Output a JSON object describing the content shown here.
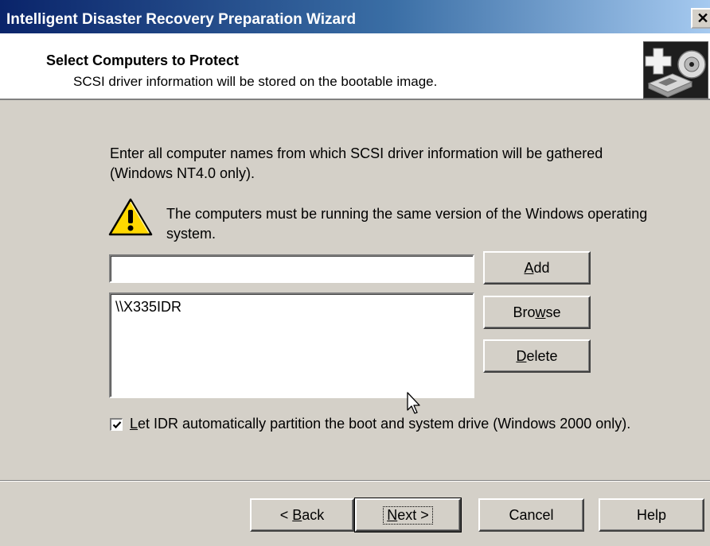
{
  "window": {
    "title": "Intelligent Disaster Recovery Preparation Wizard",
    "close_glyph": "✕",
    "close_icon": "close-icon"
  },
  "header": {
    "heading": "Select Computers to Protect",
    "subheading": "SCSI driver information will be stored on the bootable image.",
    "icon": "disaster-recovery-disk-icon"
  },
  "content": {
    "intro": "Enter all computer names from which SCSI driver information will be gathered (Windows NT4.0 only).",
    "warning_text": "The computers must be running the same version of the Windows operating system.",
    "warning_icon": "warning-icon",
    "computer_name_value": "",
    "computers": [
      "\\\\X335IDR"
    ],
    "checkbox": {
      "checked": true,
      "label_mnemonic": "L",
      "label_rest": "et IDR automatically partition the boot and system drive (Windows 2000 only)."
    }
  },
  "side_buttons": {
    "add": {
      "pre": "",
      "mnemonic": "A",
      "post": "dd"
    },
    "browse": {
      "pre": "Bro",
      "mnemonic": "w",
      "post": "se"
    },
    "delete": {
      "pre": "",
      "mnemonic": "D",
      "post": "elete"
    }
  },
  "footer": {
    "back": {
      "pre": "< ",
      "mnemonic": "B",
      "post": "ack"
    },
    "next": {
      "pre": "",
      "mnemonic": "N",
      "post": "ext >"
    },
    "cancel": "Cancel",
    "help": "Help"
  },
  "colors": {
    "title_gradient_start": "#0a246a",
    "title_gradient_end": "#a6caf0",
    "dialog_face": "#d4d0c8",
    "header_bg": "#ffffff",
    "warning_yellow": "#ffd800"
  }
}
